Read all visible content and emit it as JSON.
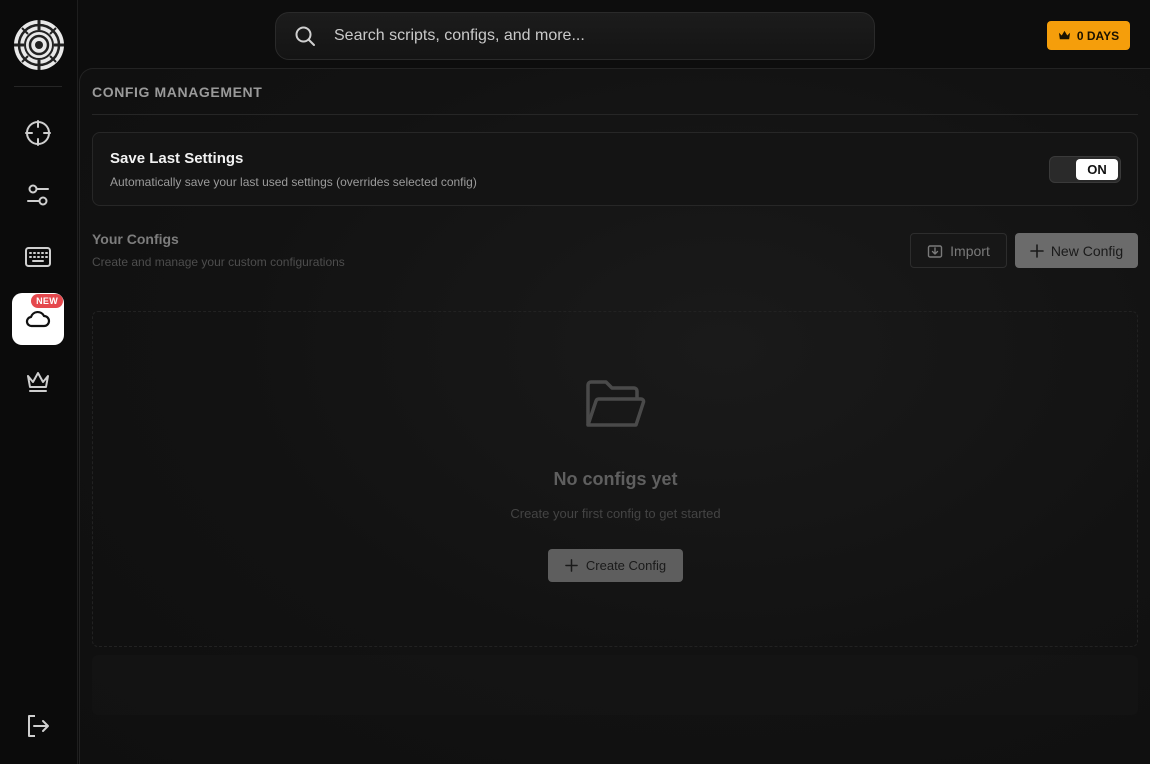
{
  "search": {
    "placeholder": "Search scripts, configs, and more..."
  },
  "subscription": {
    "days_label": "0 DAYS"
  },
  "sidebar": {
    "items": [
      {
        "name": "crosshair-icon",
        "active": false
      },
      {
        "name": "sliders-icon",
        "active": false
      },
      {
        "name": "keyboard-icon",
        "active": false
      },
      {
        "name": "cloud-icon",
        "active": true,
        "badge": "NEW"
      },
      {
        "name": "crown-icon",
        "active": false
      }
    ],
    "badge_new": "NEW"
  },
  "section": {
    "title": "CONFIG MANAGEMENT"
  },
  "save_settings": {
    "title": "Save Last Settings",
    "description": "Automatically save your last used settings (overrides selected config)",
    "toggle_label": "ON"
  },
  "configs": {
    "title": "Your Configs",
    "subtitle": "Create and manage your custom configurations",
    "import_label": "Import",
    "new_label": "New Config"
  },
  "empty_state": {
    "title": "No configs yet",
    "subtitle": "Create your first config to get started",
    "create_label": "Create Config"
  },
  "colors": {
    "accent": "#f59e0b",
    "badge": "#e5484d"
  }
}
